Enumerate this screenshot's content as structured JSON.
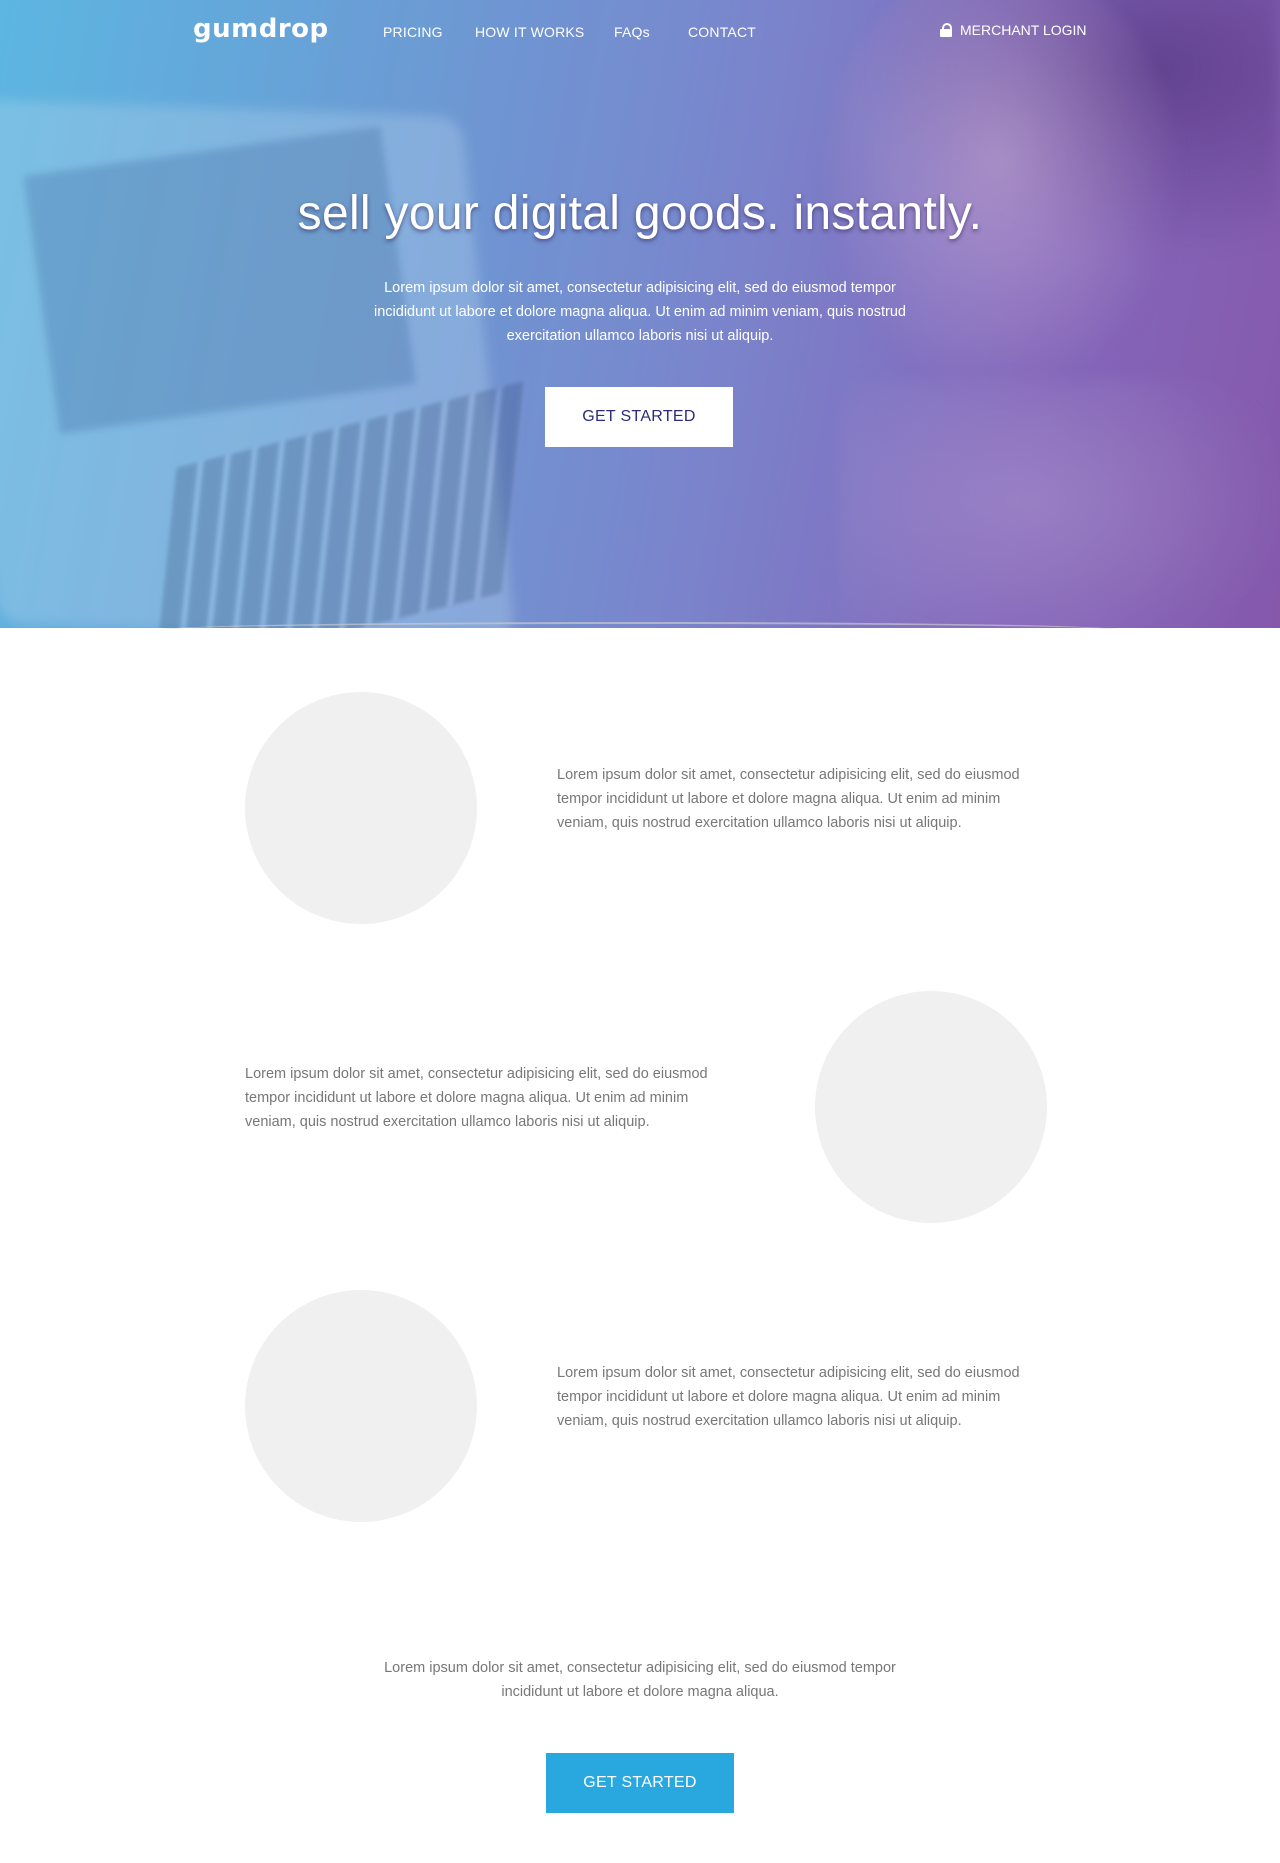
{
  "nav": {
    "logo": "gumdrop",
    "links": [
      "PRICING",
      "HOW IT WORKS",
      "FAQs",
      "CONTACT"
    ],
    "login_label": "MERCHANT LOGIN",
    "login_icon": "lock-icon"
  },
  "hero": {
    "title": "sell your digital goods. instantly.",
    "subtitle": "Lorem ipsum dolor sit amet, consectetur adipisicing elit, sed do eiusmod tempor incididunt ut labore et dolore magna aliqua. Ut enim ad minim veniam, quis nostrud exercitation ullamco laboris nisi ut aliquip.",
    "button_label": "GET STARTED",
    "gradient_start": "#5fc3ea",
    "gradient_end": "#8b5db0"
  },
  "features": [
    {
      "text": "Lorem ipsum dolor sit amet, consectetur adipisicing elit, sed do eiusmod tempor incididunt ut labore et dolore magna aliqua. Ut enim ad minim veniam, quis nostrud exercitation ullamco laboris nisi ut aliquip."
    },
    {
      "text": "Lorem ipsum dolor sit amet, consectetur adipisicing elit, sed do eiusmod tempor incididunt ut labore et dolore magna aliqua. Ut enim ad minim veniam, quis nostrud exercitation ullamco laboris nisi ut aliquip."
    },
    {
      "text": "Lorem ipsum dolor sit amet, consectetur adipisicing elit, sed do eiusmod tempor incididunt ut labore et dolore magna aliqua. Ut enim ad minim veniam, quis nostrud exercitation ullamco laboris nisi ut aliquip."
    }
  ],
  "cta": {
    "text": "Lorem ipsum dolor sit amet, consectetur adipisicing elit, sed do eiusmod tempor incididunt ut labore et dolore magna aliqua.",
    "button_label": "GET STARTED",
    "button_color": "#29a8e0"
  }
}
